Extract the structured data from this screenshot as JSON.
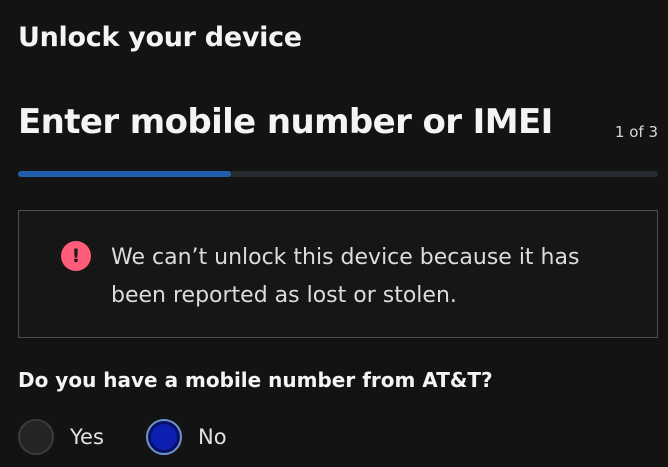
{
  "page": {
    "heading": "Unlock your device"
  },
  "step": {
    "title": "Enter mobile number or IMEI",
    "counter": "1 of 3",
    "progress_fraction": 0.333,
    "progress_color": "#1f5fae"
  },
  "alert": {
    "icon": "exclamation-icon",
    "icon_glyph": "!",
    "icon_color": "#ff5c7a",
    "message": "We can’t unlock this device because it has been reported as lost or stolen."
  },
  "question": {
    "label": "Do you have a mobile number from AT&T?",
    "options": [
      {
        "label": "Yes",
        "selected": false
      },
      {
        "label": "No",
        "selected": true
      }
    ],
    "selected_color": "#0d1fb0"
  }
}
